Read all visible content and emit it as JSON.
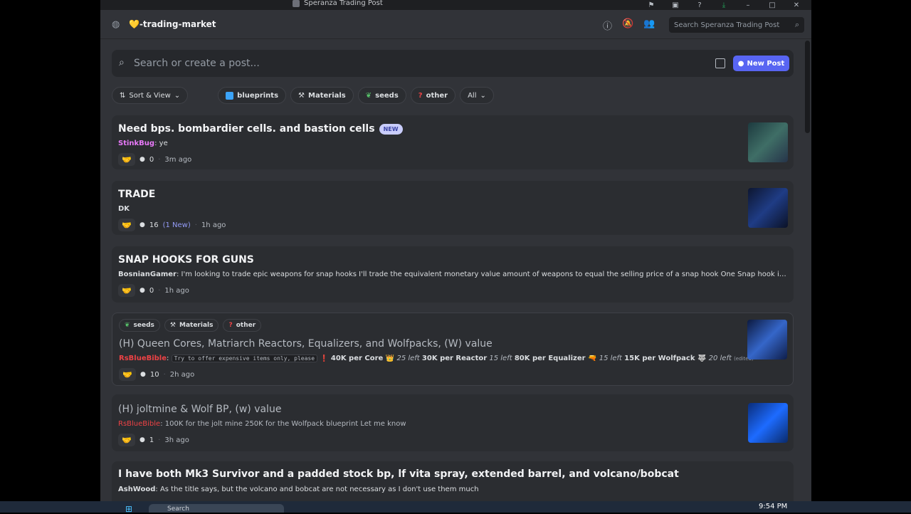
{
  "window": {
    "title": "Speranza Trading Post"
  },
  "header": {
    "channel_name": "💛-trading-market",
    "search_placeholder": "Search Speranza Trading Post"
  },
  "composer": {
    "placeholder": "Search or create a post...",
    "new_post_label": "New Post"
  },
  "filters": {
    "sort_label": "Sort & View",
    "tags": [
      "blueprints",
      "Materials",
      "seeds",
      "other"
    ],
    "all_label": "All"
  },
  "posts": [
    {
      "title": "Need bps. bombardier cells. and bastion cells",
      "badge": "NEW",
      "author": "StinkBug",
      "author_color": "#e879f9",
      "preview": "ye",
      "comments": "0",
      "time": "3m ago"
    },
    {
      "title": "TRADE",
      "author": "DK",
      "author_color": "#f2f3f5",
      "preview": "",
      "comments": "16",
      "new_comments": "(1 New)",
      "time": "1h ago"
    },
    {
      "title": "SNAP HOOKS FOR GUNS",
      "author": "BosnianGamer",
      "author_color": "#f2f3f5",
      "preview": "I'm looking to trade epic weapons for snap hooks I'll trade the equivalent monetary value amount of weapons to equal the selling price of a snap hook One Snap hook is $14,000 raider ...",
      "comments": "0",
      "time": "1h ago"
    },
    {
      "tags": [
        "seeds",
        "Materials",
        "other"
      ],
      "title": "(H) Queen Cores, Matriarch Reactors, Equalizers, and Wolfpacks, (W) value",
      "author": "RsBlueBible",
      "author_color": "#ed4245",
      "code": "Try to offer expensive items only, please",
      "seg1": "40K per Core 👑",
      "seg1b": "25 left",
      "seg2": "30K per Reactor",
      "seg2b": "15 left",
      "seg3": "80K per Equalizer 🔫",
      "seg3b": "15 left",
      "seg4": "15K per Wolfpack 🐺",
      "seg4b": "20 left",
      "edited": "(edited)",
      "comments": "10",
      "time": "2h ago"
    },
    {
      "title": "(H) joltmine & Wolf BP, (w) value",
      "author": "RsBlueBible",
      "author_color": "#ed4245",
      "preview": "100K for the jolt mine 250K for the Wolfpack blueprint Let me know",
      "comments": "1",
      "time": "3h ago"
    },
    {
      "title": "I have both Mk3 Survivor and a padded stock bp, lf vita spray, extended barrel, and volcano/bobcat",
      "author": "AshWood",
      "author_color": "#f2f3f5",
      "preview": "As the title says, but the volcano and bobcat are not necessary as I don't use them much"
    }
  ],
  "taskbar": {
    "search_label": "Search",
    "time": "9:54 PM"
  }
}
